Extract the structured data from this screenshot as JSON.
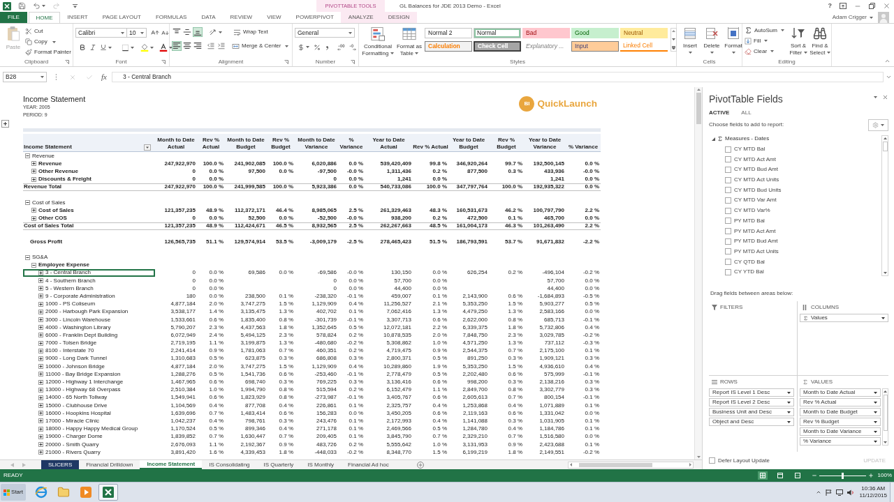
{
  "window": {
    "title": "GL Balances for JDE 2013 Demo - Excel",
    "context_tools": "PIVOTTABLE TOOLS",
    "help": "?"
  },
  "ribbon_tabs": [
    {
      "label": "FILE",
      "kind": "file",
      "selected": false
    },
    {
      "label": "HOME",
      "kind": "tab",
      "selected": true
    },
    {
      "label": "INSERT",
      "kind": "tab",
      "selected": false
    },
    {
      "label": "PAGE LAYOUT",
      "kind": "tab",
      "selected": false
    },
    {
      "label": "FORMULAS",
      "kind": "tab",
      "selected": false
    },
    {
      "label": "DATA",
      "kind": "tab",
      "selected": false
    },
    {
      "label": "REVIEW",
      "kind": "tab",
      "selected": false
    },
    {
      "label": "VIEW",
      "kind": "tab",
      "selected": false
    },
    {
      "label": "POWERPIVOT",
      "kind": "tab",
      "selected": false
    },
    {
      "label": "ANALYZE",
      "kind": "context",
      "selected": false
    },
    {
      "label": "DESIGN",
      "kind": "context",
      "selected": false
    }
  ],
  "user": {
    "name": "Adam Crigger"
  },
  "clipboard": {
    "label": "Clipboard",
    "paste": {
      "label": "Paste",
      "disabled": true
    },
    "commands": [
      {
        "kind": "cut",
        "label": "Cut"
      },
      {
        "kind": "copy",
        "label": "Copy"
      },
      {
        "kind": "format_painter",
        "label": "Format Painter"
      }
    ]
  },
  "font": {
    "label": "Font",
    "family": "Calibri",
    "size": "10"
  },
  "alignment": {
    "label": "Alignment",
    "vertical": [
      {
        "kind": "top",
        "selected": false
      },
      {
        "kind": "middle",
        "selected": false
      },
      {
        "kind": "bottom",
        "selected": true
      }
    ],
    "horizontal": [
      {
        "kind": "left",
        "selected": true
      },
      {
        "kind": "center",
        "selected": false
      },
      {
        "kind": "right",
        "selected": false
      }
    ],
    "wrap_text": "Wrap Text",
    "merge": "Merge & Center"
  },
  "number": {
    "label": "Number",
    "format": "General"
  },
  "styles": {
    "label": "Styles",
    "commands": [
      {
        "kind": "conditional",
        "label": "Conditional Formatting"
      },
      {
        "kind": "table",
        "label": "Format as Table"
      }
    ],
    "gallery": [
      {
        "label": "Normal 2",
        "kind": "plain",
        "selected": false
      },
      {
        "label": "Normal",
        "kind": "plain",
        "selected": true
      },
      {
        "label": "Bad",
        "kind": "bad",
        "selected": false
      },
      {
        "label": "Good",
        "kind": "good",
        "selected": false
      },
      {
        "label": "Neutral",
        "kind": "neutral",
        "selected": false
      },
      {
        "label": "Calculation",
        "kind": "calculation",
        "selected": false
      },
      {
        "label": "Check Cell",
        "kind": "check",
        "selected": false
      },
      {
        "label": "Explanatory ...",
        "kind": "explanatory",
        "selected": false
      },
      {
        "label": "Input",
        "kind": "input",
        "selected": false
      },
      {
        "label": "Linked Cell",
        "kind": "linked",
        "selected": false
      }
    ]
  },
  "cells": {
    "label": "Cells",
    "commands": [
      {
        "kind": "insert",
        "label": "Insert"
      },
      {
        "kind": "delete",
        "label": "Delete"
      },
      {
        "kind": "format",
        "label": "Format"
      }
    ]
  },
  "editing": {
    "label": "Editing",
    "commands": [
      {
        "kind": "autosum",
        "label": "AutoSum"
      },
      {
        "kind": "fill",
        "label": "Fill"
      },
      {
        "kind": "clear",
        "label": "Clear"
      }
    ],
    "large_commands": [
      {
        "kind": "sort",
        "label": "Sort & Filter"
      },
      {
        "kind": "find",
        "label": "Find & Select"
      }
    ]
  },
  "formula_bar": {
    "name_box": "B28",
    "function_label": "fx",
    "value": "3 - Central Branch"
  },
  "report": {
    "title": "Income Statement",
    "filters": [
      "YEAR: 2005",
      "PERIOD: 9"
    ],
    "logo": {
      "mark": "BI",
      "name": "QuickLaunch"
    },
    "columns": [
      "Income Statement",
      "Month to Date Actual",
      "Rev % Actual",
      "Month to Date Budget",
      "Rev % Budget",
      "Month to Date Variance",
      "% Variance",
      "Year to Date Actual",
      "Rev % Actual",
      "Year to Date Budget",
      "Rev % Budget",
      "Year to Date Variance",
      "% Variance"
    ],
    "rows": [
      {
        "kind": "group",
        "label": "Revenue",
        "expanded": true,
        "children": [
          {
            "label": "Revenue",
            "expanded": false,
            "values": {
              "mtd_act": "247,922,970",
              "mtd_act_rev": "100.0 %",
              "mtd_bud": "241,902,085",
              "mtd_bud_rev": "100.0 %",
              "mtd_var": "6,020,886",
              "mtd_var_pct": "0.0 %",
              "ytd_act": "539,420,409",
              "ytd_act_rev": "99.8 %",
              "ytd_bud": "346,920,264",
              "ytd_bud_rev": "99.7 %",
              "ytd_var": "192,500,145",
              "ytd_var_pct": "0.0 %"
            }
          },
          {
            "label": "Other Revenue",
            "expanded": false,
            "values": {
              "mtd_act": "0",
              "mtd_act_rev": "0.0 %",
              "mtd_bud": "97,500",
              "mtd_bud_rev": "0.0 %",
              "mtd_var": "-97,500",
              "mtd_var_pct": "-0.0 %",
              "ytd_act": "1,311,436",
              "ytd_act_rev": "0.2 %",
              "ytd_bud": "877,500",
              "ytd_bud_rev": "0.3 %",
              "ytd_var": "433,936",
              "ytd_var_pct": "-0.0 %"
            }
          },
          {
            "label": "Discounts & Freight",
            "expanded": false,
            "values": {
              "mtd_act": "0",
              "mtd_act_rev": "0.0 %",
              "mtd_var": "0",
              "mtd_var_pct": "0.0 %",
              "ytd_act": "1,241",
              "ytd_act_rev": "0.0 %",
              "ytd_var": "1,241",
              "ytd_var_pct": "0.0 %"
            }
          }
        ]
      },
      {
        "kind": "total",
        "label": "Revenue Total",
        "values": {
          "mtd_act": "247,922,970",
          "mtd_act_rev": "100.0 %",
          "mtd_bud": "241,999,585",
          "mtd_bud_rev": "100.0 %",
          "mtd_var": "5,923,386",
          "mtd_var_pct": "0.0 %",
          "ytd_act": "540,733,086",
          "ytd_act_rev": "100.0 %",
          "ytd_bud": "347,797,764",
          "ytd_bud_rev": "100.0 %",
          "ytd_var": "192,935,322",
          "ytd_var_pct": "0.0 %"
        }
      },
      {
        "kind": "group",
        "label": "Cost of Sales",
        "expanded": true,
        "children": [
          {
            "label": "Cost of Sales",
            "expanded": false,
            "values": {
              "mtd_act": "121,357,235",
              "mtd_act_rev": "48.9 %",
              "mtd_bud": "112,372,171",
              "mtd_bud_rev": "46.4 %",
              "mtd_var": "8,985,065",
              "mtd_var_pct": "2.5 %",
              "ytd_act": "261,329,463",
              "ytd_act_rev": "48.3 %",
              "ytd_bud": "160,531,673",
              "ytd_bud_rev": "46.2 %",
              "ytd_var": "100,797,790",
              "ytd_var_pct": "2.2 %"
            }
          },
          {
            "label": "Other COS",
            "expanded": false,
            "values": {
              "mtd_act": "0",
              "mtd_act_rev": "0.0 %",
              "mtd_bud": "52,500",
              "mtd_bud_rev": "0.0 %",
              "mtd_var": "-52,500",
              "mtd_var_pct": "-0.0 %",
              "ytd_act": "938,200",
              "ytd_act_rev": "0.2 %",
              "ytd_bud": "472,500",
              "ytd_bud_rev": "0.1 %",
              "ytd_var": "465,700",
              "ytd_var_pct": "0.0 %"
            }
          }
        ]
      },
      {
        "kind": "total",
        "label": "Cost of Sales Total",
        "values": {
          "mtd_act": "121,357,235",
          "mtd_act_rev": "48.9 %",
          "mtd_bud": "112,424,671",
          "mtd_bud_rev": "46.5 %",
          "mtd_var": "8,932,565",
          "mtd_var_pct": "2.5 %",
          "ytd_act": "262,267,663",
          "ytd_act_rev": "48.5 %",
          "ytd_bud": "161,004,173",
          "ytd_bud_rev": "46.3 %",
          "ytd_var": "101,263,490",
          "ytd_var_pct": "2.2 %"
        }
      },
      {
        "kind": "summary",
        "label": "Gross Profit",
        "values": {
          "mtd_act": "126,565,735",
          "mtd_act_rev": "51.1 %",
          "mtd_bud": "129,574,914",
          "mtd_bud_rev": "53.5 %",
          "mtd_var": "-3,009,179",
          "mtd_var_pct": "-2.5 %",
          "ytd_act": "278,465,423",
          "ytd_act_rev": "51.5 %",
          "ytd_bud": "186,793,591",
          "ytd_bud_rev": "53.7 %",
          "ytd_var": "91,671,832",
          "ytd_var_pct": "-2.2 %"
        }
      },
      {
        "kind": "group",
        "label": "SG&A",
        "expanded": true,
        "children": [
          {
            "label": "Employee Expense",
            "expanded": true,
            "children": [
              {
                "label": "3 - Central Branch",
                "expanded": false,
                "selected": true,
                "values": {
                  "mtd_act": "0",
                  "mtd_act_rev": "0.0 %",
                  "mtd_bud": "69,586",
                  "mtd_bud_rev": "0.0 %",
                  "mtd_var": "-69,586",
                  "mtd_var_pct": "-0.0 %",
                  "ytd_act": "130,150",
                  "ytd_act_rev": "0.0 %",
                  "ytd_bud": "626,254",
                  "ytd_bud_rev": "0.2 %",
                  "ytd_var": "-496,104",
                  "ytd_var_pct": "-0.2 %"
                }
              },
              {
                "label": "4 - Southern Branch",
                "expanded": false,
                "selected": false,
                "values": {
                  "mtd_act": "0",
                  "mtd_act_rev": "0.0 %",
                  "mtd_var": "0",
                  "mtd_var_pct": "0.0 %",
                  "ytd_act": "57,700",
                  "ytd_act_rev": "0.0 %",
                  "ytd_var": "57,700",
                  "ytd_var_pct": "0.0 %"
                }
              },
              {
                "label": "5 - Western Branch",
                "expanded": false,
                "selected": false,
                "values": {
                  "mtd_act": "0",
                  "mtd_act_rev": "0.0 %",
                  "mtd_var": "0",
                  "mtd_var_pct": "0.0 %",
                  "ytd_act": "44,400",
                  "ytd_act_rev": "0.0 %",
                  "ytd_var": "44,400",
                  "ytd_var_pct": "0.0 %"
                }
              },
              {
                "label": "9 - Corporate Administration",
                "expanded": false,
                "selected": false,
                "values": {
                  "mtd_act": "180",
                  "mtd_act_rev": "0.0 %",
                  "mtd_bud": "238,500",
                  "mtd_bud_rev": "0.1 %",
                  "mtd_var": "-238,320",
                  "mtd_var_pct": "-0.1 %",
                  "ytd_act": "459,007",
                  "ytd_act_rev": "0.1 %",
                  "ytd_bud": "2,143,900",
                  "ytd_bud_rev": "0.6 %",
                  "ytd_var": "-1,684,893",
                  "ytd_var_pct": "-0.5 %"
                }
              },
              {
                "label": "1000 - PS Coliseum",
                "expanded": false,
                "selected": false,
                "values": {
                  "mtd_act": "4,877,184",
                  "mtd_act_rev": "2.0 %",
                  "mtd_bud": "3,747,275",
                  "mtd_bud_rev": "1.5 %",
                  "mtd_var": "1,129,909",
                  "mtd_var_pct": "0.4 %",
                  "ytd_act": "11,256,527",
                  "ytd_act_rev": "2.1 %",
                  "ytd_bud": "5,353,250",
                  "ytd_bud_rev": "1.5 %",
                  "ytd_var": "5,903,277",
                  "ytd_var_pct": "0.5 %"
                }
              },
              {
                "label": "2000 - Harbough Park Expansion",
                "expanded": false,
                "selected": false,
                "values": {
                  "mtd_act": "3,538,177",
                  "mtd_act_rev": "1.4 %",
                  "mtd_bud": "3,135,475",
                  "mtd_bud_rev": "1.3 %",
                  "mtd_var": "402,702",
                  "mtd_var_pct": "0.1 %",
                  "ytd_act": "7,062,416",
                  "ytd_act_rev": "1.3 %",
                  "ytd_bud": "4,479,250",
                  "ytd_bud_rev": "1.3 %",
                  "ytd_var": "2,583,166",
                  "ytd_var_pct": "0.0 %"
                }
              },
              {
                "label": "3000 - Lincoln Warehouse",
                "expanded": false,
                "selected": false,
                "values": {
                  "mtd_act": "1,533,661",
                  "mtd_act_rev": "0.6 %",
                  "mtd_bud": "1,835,400",
                  "mtd_bud_rev": "0.8 %",
                  "mtd_var": "-301,739",
                  "mtd_var_pct": "-0.1 %",
                  "ytd_act": "3,307,713",
                  "ytd_act_rev": "0.6 %",
                  "ytd_bud": "2,622,000",
                  "ytd_bud_rev": "0.8 %",
                  "ytd_var": "685,713",
                  "ytd_var_pct": "-0.1 %"
                }
              },
              {
                "label": "4000 - Washington Library",
                "expanded": false,
                "selected": false,
                "values": {
                  "mtd_act": "5,790,207",
                  "mtd_act_rev": "2.3 %",
                  "mtd_bud": "4,437,563",
                  "mtd_bud_rev": "1.8 %",
                  "mtd_var": "1,352,645",
                  "mtd_var_pct": "0.5 %",
                  "ytd_act": "12,072,181",
                  "ytd_act_rev": "2.2 %",
                  "ytd_bud": "6,339,375",
                  "ytd_bud_rev": "1.8 %",
                  "ytd_var": "5,732,806",
                  "ytd_var_pct": "0.4 %"
                }
              },
              {
                "label": "6000 - Franklin Dept Building",
                "expanded": false,
                "selected": false,
                "values": {
                  "mtd_act": "6,072,949",
                  "mtd_act_rev": "2.4 %",
                  "mtd_bud": "5,494,125",
                  "mtd_bud_rev": "2.3 %",
                  "mtd_var": "578,824",
                  "mtd_var_pct": "0.2 %",
                  "ytd_act": "10,878,535",
                  "ytd_act_rev": "2.0 %",
                  "ytd_bud": "7,848,750",
                  "ytd_bud_rev": "2.3 %",
                  "ytd_var": "3,029,785",
                  "ytd_var_pct": "-0.2 %"
                }
              },
              {
                "label": "7000 - Tolsen Bridge",
                "expanded": false,
                "selected": false,
                "values": {
                  "mtd_act": "2,719,195",
                  "mtd_act_rev": "1.1 %",
                  "mtd_bud": "3,199,875",
                  "mtd_bud_rev": "1.3 %",
                  "mtd_var": "-480,680",
                  "mtd_var_pct": "-0.2 %",
                  "ytd_act": "5,308,862",
                  "ytd_act_rev": "1.0 %",
                  "ytd_bud": "4,571,250",
                  "ytd_bud_rev": "1.3 %",
                  "ytd_var": "737,112",
                  "ytd_var_pct": "-0.3 %"
                }
              },
              {
                "label": "8100 - Interstate 70",
                "expanded": false,
                "selected": false,
                "values": {
                  "mtd_act": "2,241,414",
                  "mtd_act_rev": "0.9 %",
                  "mtd_bud": "1,781,063",
                  "mtd_bud_rev": "0.7 %",
                  "mtd_var": "460,351",
                  "mtd_var_pct": "0.2 %",
                  "ytd_act": "4,719,475",
                  "ytd_act_rev": "0.9 %",
                  "ytd_bud": "2,544,375",
                  "ytd_bud_rev": "0.7 %",
                  "ytd_var": "2,175,100",
                  "ytd_var_pct": "0.1 %"
                }
              },
              {
                "label": "9000 - Long Dark Tunnel",
                "expanded": false,
                "selected": false,
                "values": {
                  "mtd_act": "1,310,683",
                  "mtd_act_rev": "0.5 %",
                  "mtd_bud": "623,875",
                  "mtd_bud_rev": "0.3 %",
                  "mtd_var": "686,808",
                  "mtd_var_pct": "0.3 %",
                  "ytd_act": "2,800,371",
                  "ytd_act_rev": "0.5 %",
                  "ytd_bud": "891,250",
                  "ytd_bud_rev": "0.3 %",
                  "ytd_var": "1,909,121",
                  "ytd_var_pct": "0.3 %"
                }
              },
              {
                "label": "10000 - Johnson Bridge",
                "expanded": false,
                "selected": false,
                "values": {
                  "mtd_act": "4,877,184",
                  "mtd_act_rev": "2.0 %",
                  "mtd_bud": "3,747,275",
                  "mtd_bud_rev": "1.5 %",
                  "mtd_var": "1,129,909",
                  "mtd_var_pct": "0.4 %",
                  "ytd_act": "10,289,860",
                  "ytd_act_rev": "1.9 %",
                  "ytd_bud": "5,353,250",
                  "ytd_bud_rev": "1.5 %",
                  "ytd_var": "4,936,610",
                  "ytd_var_pct": "0.4 %"
                }
              },
              {
                "label": "11000 - Bay Bridge Expansion",
                "expanded": false,
                "selected": false,
                "values": {
                  "mtd_act": "1,288,276",
                  "mtd_act_rev": "0.5 %",
                  "mtd_bud": "1,541,736",
                  "mtd_bud_rev": "0.6 %",
                  "mtd_var": "-253,460",
                  "mtd_var_pct": "-0.1 %",
                  "ytd_act": "2,778,479",
                  "ytd_act_rev": "0.5 %",
                  "ytd_bud": "2,202,480",
                  "ytd_bud_rev": "0.6 %",
                  "ytd_var": "575,999",
                  "ytd_var_pct": "-0.1 %"
                }
              },
              {
                "label": "12000 - Highway 1 Interchange",
                "expanded": false,
                "selected": false,
                "values": {
                  "mtd_act": "1,467,965",
                  "mtd_act_rev": "0.6 %",
                  "mtd_bud": "698,740",
                  "mtd_bud_rev": "0.3 %",
                  "mtd_var": "769,225",
                  "mtd_var_pct": "0.3 %",
                  "ytd_act": "3,136,416",
                  "ytd_act_rev": "0.6 %",
                  "ytd_bud": "998,200",
                  "ytd_bud_rev": "0.3 %",
                  "ytd_var": "2,138,216",
                  "ytd_var_pct": "0.3 %"
                }
              },
              {
                "label": "13000 - Highway 68 Overpass",
                "expanded": false,
                "selected": false,
                "values": {
                  "mtd_act": "2,510,384",
                  "mtd_act_rev": "1.0 %",
                  "mtd_bud": "1,994,790",
                  "mtd_bud_rev": "0.8 %",
                  "mtd_var": "515,594",
                  "mtd_var_pct": "0.2 %",
                  "ytd_act": "6,152,479",
                  "ytd_act_rev": "1.1 %",
                  "ytd_bud": "2,849,700",
                  "ytd_bud_rev": "0.8 %",
                  "ytd_var": "3,302,779",
                  "ytd_var_pct": "0.3 %"
                }
              },
              {
                "label": "14000 - 65 North Tollway",
                "expanded": false,
                "selected": false,
                "values": {
                  "mtd_act": "1,549,941",
                  "mtd_act_rev": "0.6 %",
                  "mtd_bud": "1,823,929",
                  "mtd_bud_rev": "0.8 %",
                  "mtd_var": "-273,987",
                  "mtd_var_pct": "-0.1 %",
                  "ytd_act": "3,405,767",
                  "ytd_act_rev": "0.6 %",
                  "ytd_bud": "2,605,613",
                  "ytd_bud_rev": "0.7 %",
                  "ytd_var": "800,154",
                  "ytd_var_pct": "-0.1 %"
                }
              },
              {
                "label": "15000 - Clubhouse Drive",
                "expanded": false,
                "selected": false,
                "values": {
                  "mtd_act": "1,104,569",
                  "mtd_act_rev": "0.4 %",
                  "mtd_bud": "877,708",
                  "mtd_bud_rev": "0.4 %",
                  "mtd_var": "226,861",
                  "mtd_var_pct": "0.1 %",
                  "ytd_act": "2,325,757",
                  "ytd_act_rev": "0.4 %",
                  "ytd_bud": "1,253,868",
                  "ytd_bud_rev": "0.4 %",
                  "ytd_var": "1,071,889",
                  "ytd_var_pct": "0.1 %"
                }
              },
              {
                "label": "16000 - Hoopkins Hospital",
                "expanded": false,
                "selected": false,
                "values": {
                  "mtd_act": "1,639,696",
                  "mtd_act_rev": "0.7 %",
                  "mtd_bud": "1,483,414",
                  "mtd_bud_rev": "0.6 %",
                  "mtd_var": "156,283",
                  "mtd_var_pct": "0.0 %",
                  "ytd_act": "3,450,205",
                  "ytd_act_rev": "0.6 %",
                  "ytd_bud": "2,119,163",
                  "ytd_bud_rev": "0.6 %",
                  "ytd_var": "1,331,042",
                  "ytd_var_pct": "0.0 %"
                }
              },
              {
                "label": "17000 - Miracle Clinic",
                "expanded": false,
                "selected": false,
                "values": {
                  "mtd_act": "1,042,237",
                  "mtd_act_rev": "0.4 %",
                  "mtd_bud": "798,761",
                  "mtd_bud_rev": "0.3 %",
                  "mtd_var": "243,476",
                  "mtd_var_pct": "0.1 %",
                  "ytd_act": "2,172,993",
                  "ytd_act_rev": "0.4 %",
                  "ytd_bud": "1,141,088",
                  "ytd_bud_rev": "0.3 %",
                  "ytd_var": "1,031,905",
                  "ytd_var_pct": "0.1 %"
                }
              },
              {
                "label": "18000 - Happy Happy Medical Group",
                "expanded": false,
                "selected": false,
                "values": {
                  "mtd_act": "1,170,524",
                  "mtd_act_rev": "0.5 %",
                  "mtd_bud": "899,346",
                  "mtd_bud_rev": "0.4 %",
                  "mtd_var": "271,178",
                  "mtd_var_pct": "0.1 %",
                  "ytd_act": "2,469,566",
                  "ytd_act_rev": "0.5 %",
                  "ytd_bud": "1,284,780",
                  "ytd_bud_rev": "0.4 %",
                  "ytd_var": "1,184,786",
                  "ytd_var_pct": "0.1 %"
                }
              },
              {
                "label": "19000 - Charger Dome",
                "expanded": false,
                "selected": false,
                "values": {
                  "mtd_act": "1,839,852",
                  "mtd_act_rev": "0.7 %",
                  "mtd_bud": "1,630,447",
                  "mtd_bud_rev": "0.7 %",
                  "mtd_var": "209,405",
                  "mtd_var_pct": "0.1 %",
                  "ytd_act": "3,845,790",
                  "ytd_act_rev": "0.7 %",
                  "ytd_bud": "2,329,210",
                  "ytd_bud_rev": "0.7 %",
                  "ytd_var": "1,516,580",
                  "ytd_var_pct": "0.0 %"
                }
              },
              {
                "label": "20000 - Smith Quarry",
                "expanded": false,
                "selected": false,
                "values": {
                  "mtd_act": "2,676,093",
                  "mtd_act_rev": "1.1 %",
                  "mtd_bud": "2,192,367",
                  "mtd_bud_rev": "0.9 %",
                  "mtd_var": "483,726",
                  "mtd_var_pct": "0.2 %",
                  "ytd_act": "5,555,642",
                  "ytd_act_rev": "1.0 %",
                  "ytd_bud": "3,131,953",
                  "ytd_bud_rev": "0.9 %",
                  "ytd_var": "2,423,688",
                  "ytd_var_pct": "0.1 %"
                }
              },
              {
                "label": "21000 - Rivers Quarry",
                "expanded": false,
                "selected": false,
                "values": {
                  "mtd_act": "3,891,420",
                  "mtd_act_rev": "1.6 %",
                  "mtd_bud": "4,339,453",
                  "mtd_bud_rev": "1.8 %",
                  "mtd_var": "-448,033",
                  "mtd_var_pct": "-0.2 %",
                  "ytd_act": "8,348,770",
                  "ytd_act_rev": "1.5 %",
                  "ytd_bud": "6,199,219",
                  "ytd_bud_rev": "1.8 %",
                  "ytd_var": "2,149,551",
                  "ytd_var_pct": "-0.2 %"
                }
              }
            ]
          }
        ]
      }
    ]
  },
  "sheet_tabs": [
    {
      "label": "SLICERS",
      "selected": false,
      "color": "#1f3864"
    },
    {
      "label": "Financial Drilldown",
      "selected": false
    },
    {
      "label": "Income Statement",
      "selected": true
    },
    {
      "label": "IS Consolidating",
      "selected": false
    },
    {
      "label": "IS Quarterly",
      "selected": false
    },
    {
      "label": "IS Monthly",
      "selected": false
    },
    {
      "label": "Financial Ad hoc",
      "selected": false
    }
  ],
  "pivot_fields": {
    "title": "PivotTable Fields",
    "tabs": [
      {
        "label": "ACTIVE",
        "selected": true
      },
      {
        "label": "ALL",
        "selected": false
      }
    ],
    "prompt": "Choose fields to add to report:",
    "field_groups": [
      {
        "label": "Measures - Dates",
        "expanded": true,
        "children": [
          {
            "label": "CY MTD Bal",
            "checked": false
          },
          {
            "label": "CY MTD Act Amt",
            "checked": false
          },
          {
            "label": "CY MTD Bud Amt",
            "checked": false
          },
          {
            "label": "CY MTD Act Units",
            "checked": false
          },
          {
            "label": "CY MTD Bud Units",
            "checked": false
          },
          {
            "label": "CY MTD Var Amt",
            "checked": false
          },
          {
            "label": "CY MTD Var%",
            "checked": false
          },
          {
            "label": "PY MTD Bal",
            "checked": false
          },
          {
            "label": "PY MTD Act Amt",
            "checked": false
          },
          {
            "label": "PY MTD Bud Amt",
            "checked": false
          },
          {
            "label": "PY MTD Act Units",
            "checked": false
          },
          {
            "label": "CY QTD Bal",
            "checked": false
          },
          {
            "label": "CY YTD Bal",
            "checked": false
          }
        ]
      }
    ],
    "areas_prompt": "Drag fields between areas below:",
    "areas": [
      {
        "kind": "filters",
        "label": "FILTERS"
      },
      {
        "kind": "columns",
        "label": "COLUMNS",
        "fields": [
          {
            "kind": "sigma",
            "label": "Values"
          }
        ]
      },
      {
        "kind": "rows",
        "label": "ROWS",
        "fields": [
          {
            "kind": "field",
            "label": "Report IS Level 1 Desc"
          },
          {
            "kind": "field",
            "label": "Report IS Level 2 Desc"
          },
          {
            "kind": "field",
            "label": "Business Unit and Desc"
          },
          {
            "kind": "field",
            "label": "Object and Desc"
          }
        ]
      },
      {
        "kind": "values",
        "label": "VALUES",
        "fields": [
          {
            "kind": "field",
            "label": "Month to Date Actual"
          },
          {
            "kind": "field",
            "label": "Rev % Actual"
          },
          {
            "kind": "field",
            "label": "Month to Date Budget"
          },
          {
            "kind": "field",
            "label": "Rev % Budget"
          },
          {
            "kind": "field",
            "label": "Month to Date Variance"
          },
          {
            "kind": "field",
            "label": "% Variance"
          }
        ]
      }
    ],
    "defer": {
      "label": "Defer Layout Update",
      "checked": false
    },
    "update": {
      "label": "UPDATE",
      "disabled": true
    }
  },
  "status_bar": {
    "mode": "READY",
    "views": [
      {
        "kind": "normal",
        "selected": true
      },
      {
        "kind": "page_layout",
        "selected": false
      },
      {
        "kind": "page_break",
        "selected": false
      }
    ],
    "zoom": {
      "level": 0.5,
      "reading": "100%"
    }
  },
  "taskbar": {
    "start": "Start",
    "apps": [
      {
        "kind": "browser",
        "selected": false
      },
      {
        "kind": "folder",
        "selected": false
      },
      {
        "kind": "media",
        "selected": false
      },
      {
        "kind": "spreadsheet",
        "selected": true
      }
    ],
    "time": "10:36 AM",
    "date": "11/12/2015"
  }
}
